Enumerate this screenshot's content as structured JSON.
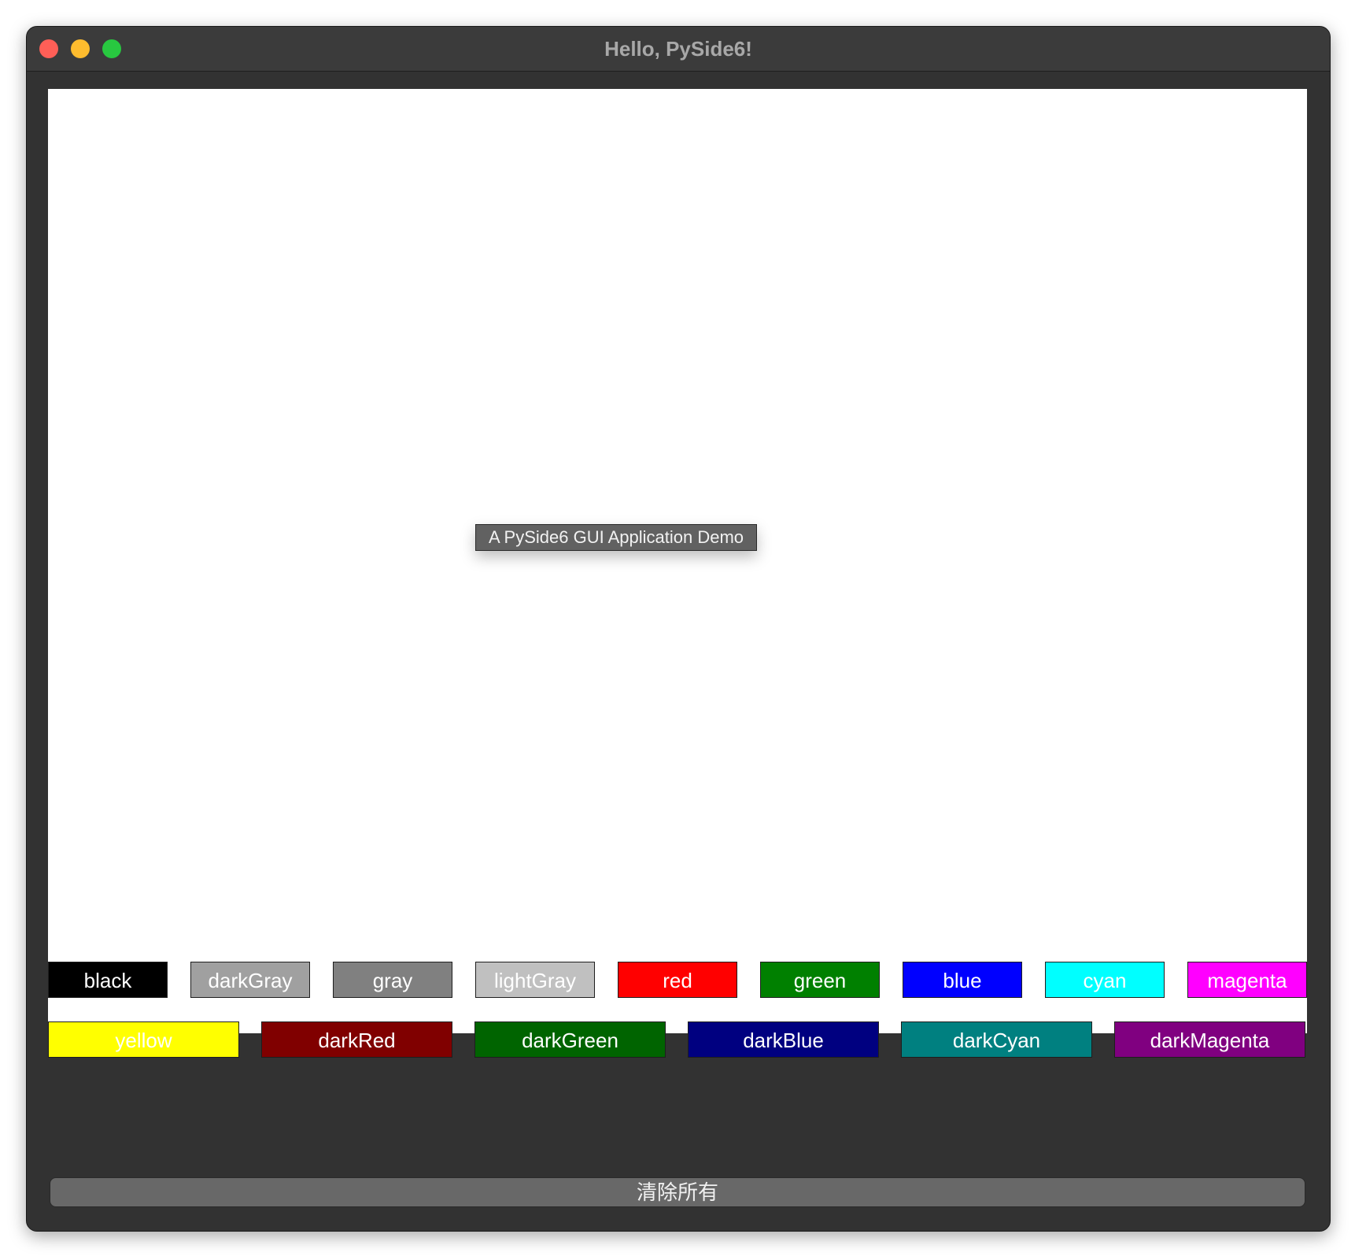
{
  "window": {
    "title": "Hello, PySide6!"
  },
  "canvas": {
    "tooltip": "A PySide6 GUI Application Demo"
  },
  "palette": {
    "row1": [
      {
        "label": "black",
        "bg": "#000000",
        "fg": "#ffffff"
      },
      {
        "label": "darkGray",
        "bg": "#a0a0a0",
        "fg": "#ffffff"
      },
      {
        "label": "gray",
        "bg": "#808080",
        "fg": "#ffffff"
      },
      {
        "label": "lightGray",
        "bg": "#c0c0c0",
        "fg": "#ffffff"
      },
      {
        "label": "red",
        "bg": "#ff0000",
        "fg": "#ffffff"
      },
      {
        "label": "green",
        "bg": "#008000",
        "fg": "#ffffff"
      },
      {
        "label": "blue",
        "bg": "#0000ff",
        "fg": "#ffffff"
      },
      {
        "label": "cyan",
        "bg": "#00ffff",
        "fg": "#ffffff"
      },
      {
        "label": "magenta",
        "bg": "#ff00ff",
        "fg": "#ffffff"
      }
    ],
    "row2": [
      {
        "label": "yellow",
        "bg": "#ffff00",
        "fg": "#ffffff"
      },
      {
        "label": "darkRed",
        "bg": "#800000",
        "fg": "#ffffff"
      },
      {
        "label": "darkGreen",
        "bg": "#006400",
        "fg": "#ffffff"
      },
      {
        "label": "darkBlue",
        "bg": "#000080",
        "fg": "#ffffff"
      },
      {
        "label": "darkCyan",
        "bg": "#008080",
        "fg": "#ffffff"
      },
      {
        "label": "darkMagenta",
        "bg": "#800080",
        "fg": "#ffffff"
      }
    ]
  },
  "clear_button": {
    "label": "清除所有"
  }
}
